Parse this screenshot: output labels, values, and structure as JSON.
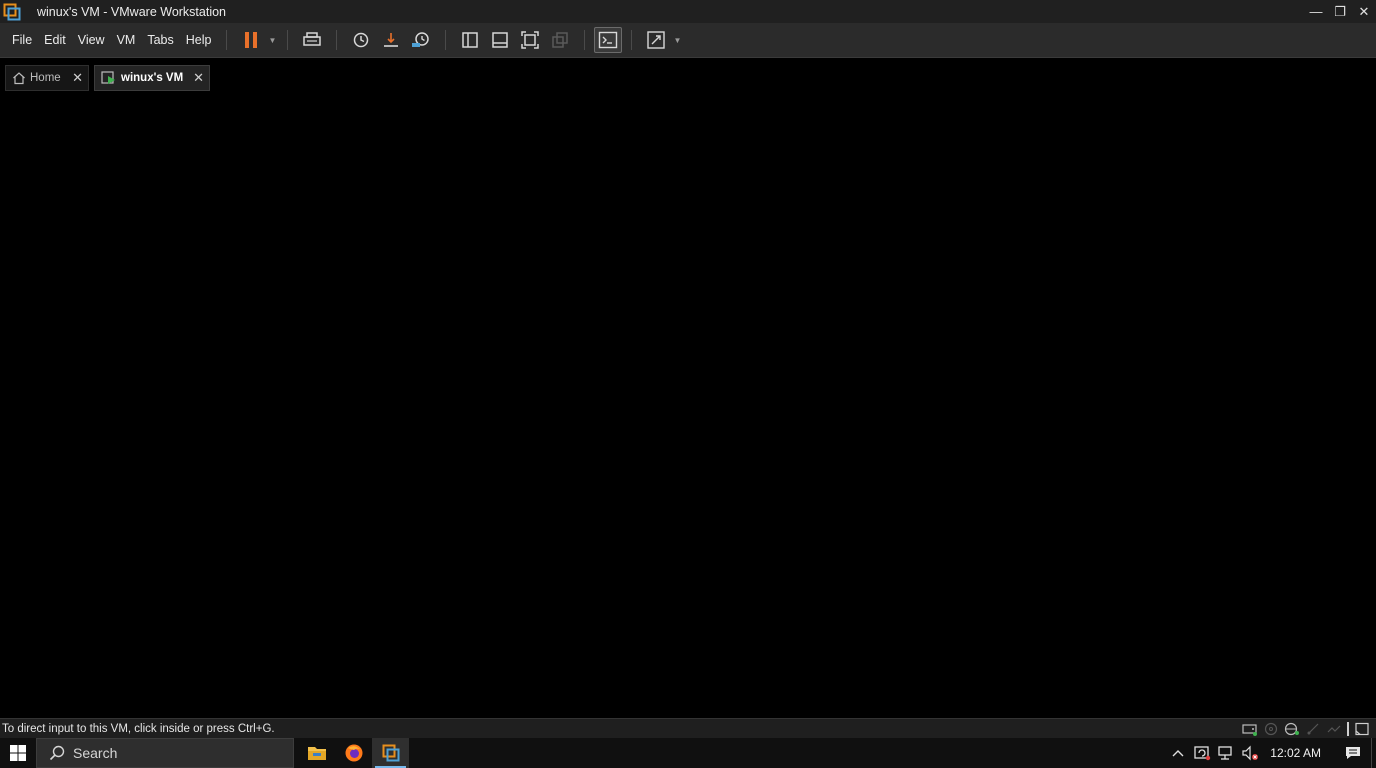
{
  "window": {
    "title": "winux's VM  - VMware Workstation",
    "minimize_glyph": "—",
    "maximize_glyph": "❐",
    "close_glyph": "✕"
  },
  "menu": {
    "items": [
      "File",
      "Edit",
      "View",
      "VM",
      "Tabs",
      "Help"
    ]
  },
  "toolbar": {
    "icons": [
      "pause-icon",
      "send-ctrl-alt-del-icon",
      "snapshot-icon",
      "revert-snapshot-icon",
      "snapshot-manager-icon",
      "show-library-icon",
      "thumbnail-bar-icon",
      "full-screen-icon",
      "unity-icon",
      "console-view-icon",
      "stretch-guest-icon"
    ],
    "accent_color": "#e8702a"
  },
  "tabs": [
    {
      "label": "Home",
      "icon": "home-icon",
      "active": false
    },
    {
      "label": "winux's VM",
      "icon": "vm-running-icon",
      "active": true
    }
  ],
  "status": {
    "message": "To direct input to this VM, click inside or press Ctrl+G."
  },
  "taskbar": {
    "search_label": "Search",
    "apps": [
      "file-explorer-icon",
      "firefox-icon",
      "vmware-workstation-icon"
    ],
    "active_app": "vmware-workstation-icon",
    "clock": "12:02 AM"
  }
}
